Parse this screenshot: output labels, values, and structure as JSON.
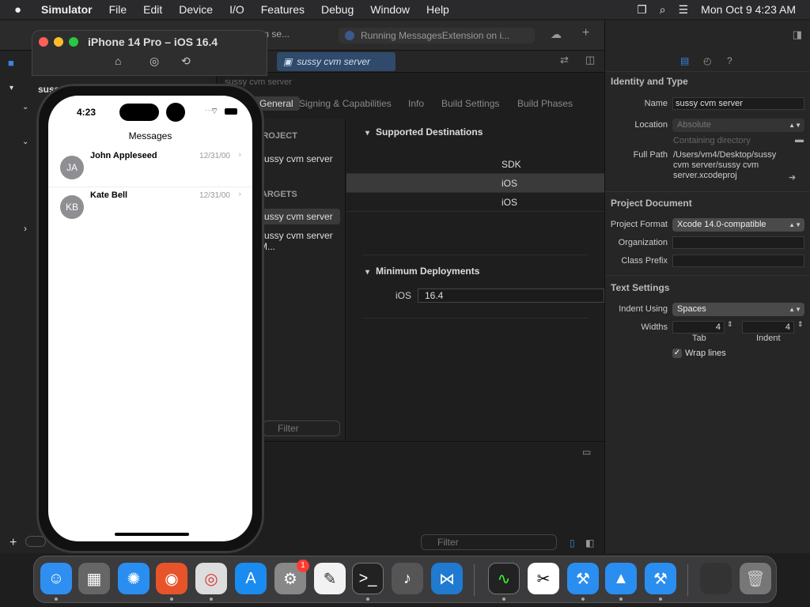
{
  "menubar": {
    "app": "Simulator",
    "items": [
      "File",
      "Edit",
      "Device",
      "I/O",
      "Features",
      "Debug",
      "Window",
      "Help"
    ],
    "datetime": "Mon Oct 9  4:23 AM"
  },
  "xcode": {
    "project_short": "sussy cvm se...",
    "run_status": "Running MessagesExtension on i...",
    "editor_tab": "sussy cvm server",
    "breadcrumb": "sussy cvm server",
    "navigator_root": "suss",
    "settings_tabs": [
      "General",
      "Signing & Capabilities",
      "Info",
      "Build Settings",
      "Build Phases"
    ],
    "project_header": "PROJECT",
    "project_item": "sussy cvm server",
    "targets_header": "TARGETS",
    "targets": [
      "sussy cvm server",
      "sussy cvm server M..."
    ],
    "filter_placeholder": "Filter",
    "supported_destinations": {
      "title": "Supported Destinations",
      "column": "SDK",
      "rows": [
        "iOS",
        "iOS"
      ]
    },
    "minimum_deployments": {
      "title": "Minimum Deployments",
      "label": "iOS",
      "value": "16.4"
    }
  },
  "inspector": {
    "identity_title": "Identity and Type",
    "name_label": "Name",
    "name_value": "sussy cvm server",
    "location_label": "Location",
    "location_value": "Absolute",
    "containing_dir": "Containing directory",
    "full_path_label": "Full Path",
    "full_path_value": "/Users/vm4/Desktop/sussy cvm server/sussy cvm server.xcodeproj",
    "project_document_title": "Project Document",
    "project_format_label": "Project Format",
    "project_format_value": "Xcode 14.0-compatible",
    "organization_label": "Organization",
    "class_prefix_label": "Class Prefix",
    "text_settings_title": "Text Settings",
    "indent_using_label": "Indent Using",
    "indent_using_value": "Spaces",
    "widths_label": "Widths",
    "tab_value": "4",
    "indent_value": "4",
    "tab_caption": "Tab",
    "indent_caption": "Indent",
    "wrap_lines": "Wrap lines"
  },
  "simulator": {
    "title": "iPhone 14 Pro – iOS 16.4",
    "time": "4:23",
    "screen_title": "Messages",
    "contacts": [
      {
        "initials": "JA",
        "name": "John Appleseed",
        "date": "12/31/00"
      },
      {
        "initials": "KB",
        "name": "Kate Bell",
        "date": "12/31/00"
      }
    ]
  },
  "dock": {
    "settings_badge": "1"
  },
  "colors": {
    "accent": "#2f6fd6",
    "selection": "#3a3a3a"
  }
}
